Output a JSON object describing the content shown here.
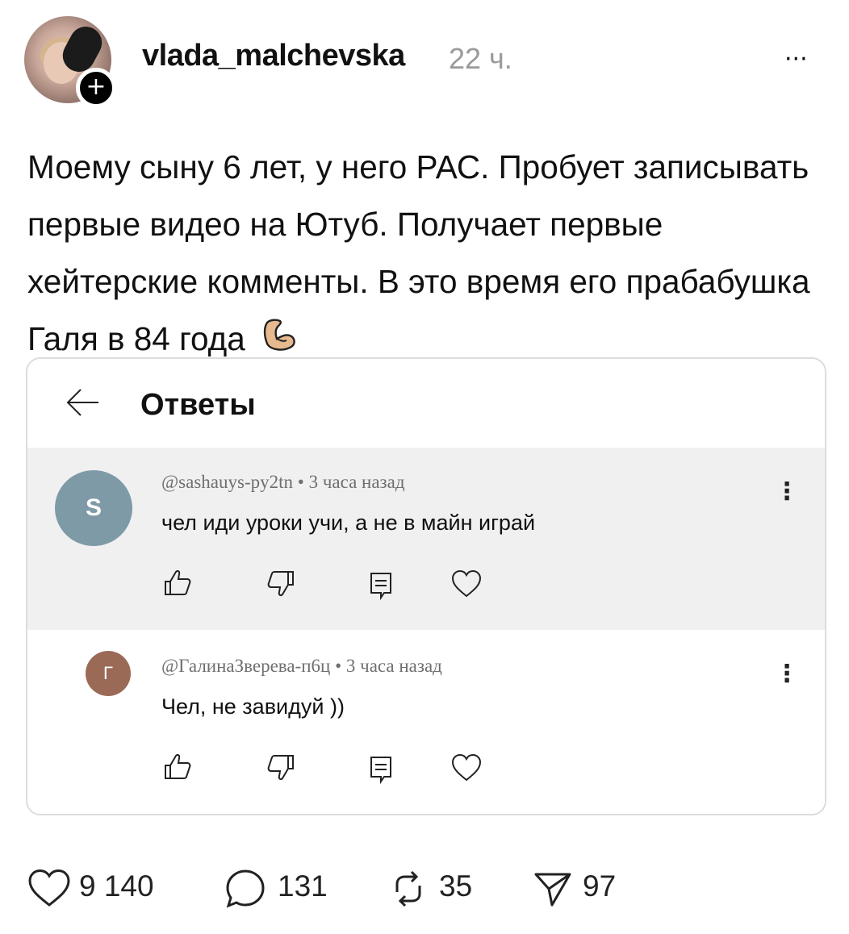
{
  "post": {
    "username": "vlada_malchevska",
    "time": "22 ч.",
    "more": "···",
    "text": "Моему сыну 6 лет, у него РАС. Пробует записывать первые видео на Ютуб. Получает первые хейтерские комменты. В это время его прабабушка Галя в 84 года",
    "emoji": "flexed-biceps"
  },
  "embed": {
    "title": "Ответы",
    "comments": [
      {
        "avatar_letter": "S",
        "avatar_color": "#7f9aa7",
        "author": "@sashauys-py2tn",
        "time": "3 часа назад",
        "text": "чел иди уроки учи, а не в майн играй"
      },
      {
        "avatar_letter": "Г",
        "avatar_color": "#9b6a57",
        "author": "@ГалинаЗверева-п6ц",
        "time": "3 часа назад",
        "text": "Чел, не завидуй ))"
      }
    ]
  },
  "stats": {
    "likes": "9 140",
    "comments": "131",
    "reposts": "35",
    "shares": "97"
  },
  "colors": {
    "muted": "#9a9a9a",
    "highlight_bg": "#f0f0f0"
  }
}
